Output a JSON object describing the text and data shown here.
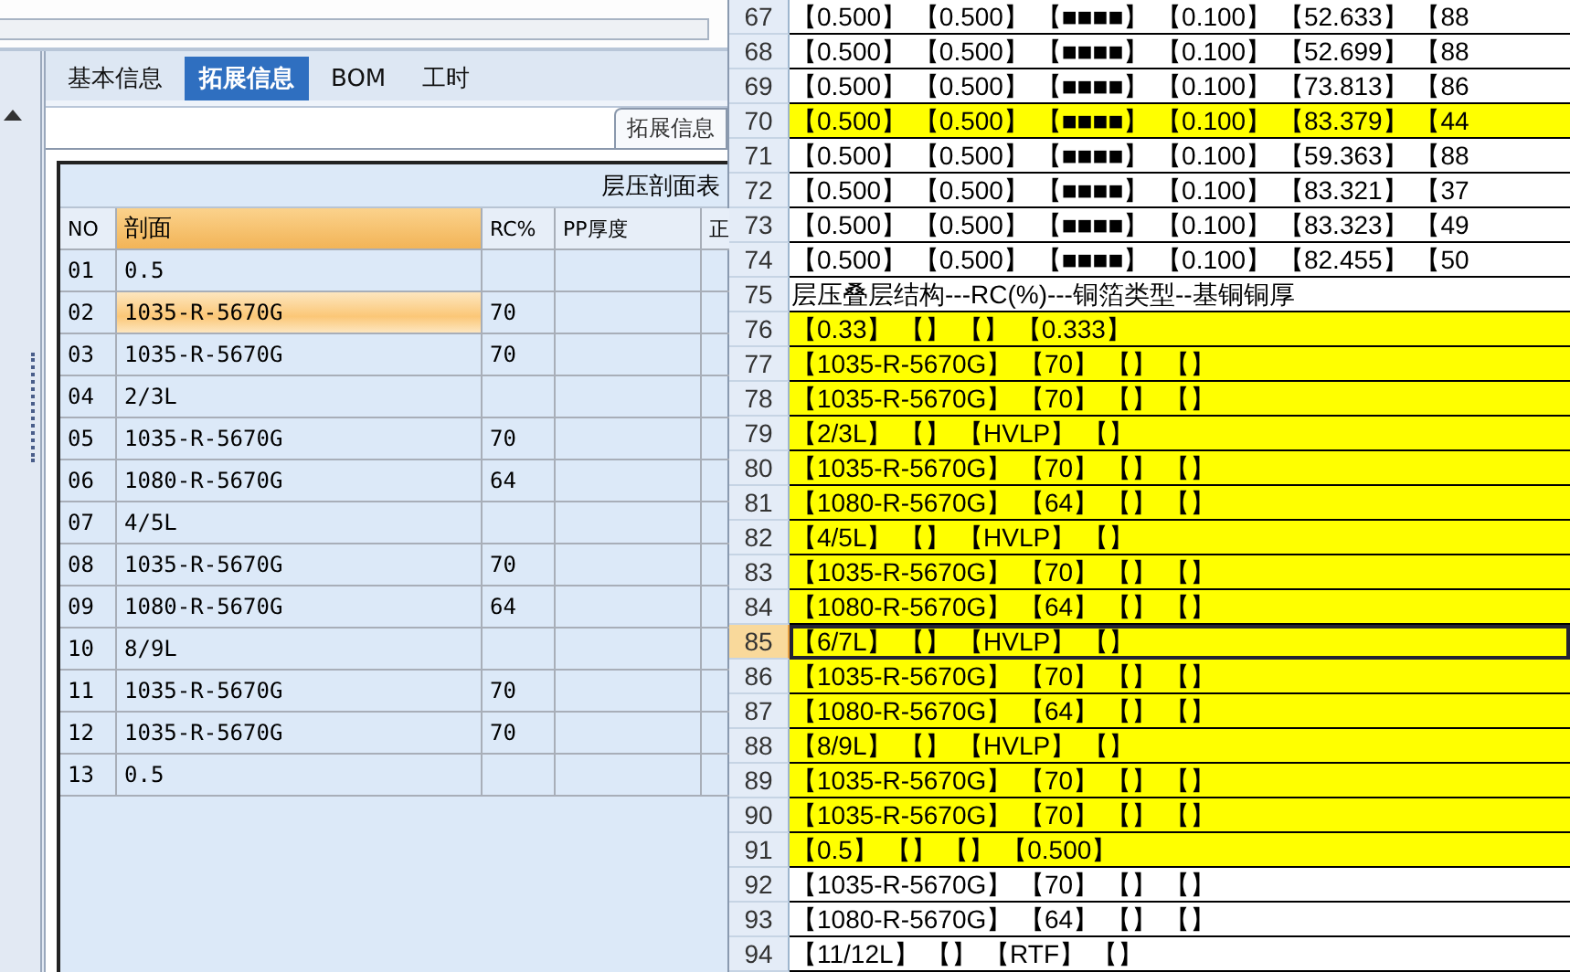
{
  "tabs": [
    {
      "label": "基本信息",
      "selected": false
    },
    {
      "label": "拓展信息",
      "selected": true
    },
    {
      "label": "BOM",
      "selected": false
    },
    {
      "label": "工时",
      "selected": false
    }
  ],
  "sub_tab": {
    "label": "拓展信息"
  },
  "grid": {
    "title": "层压剖面表",
    "columns": [
      {
        "label": "NO",
        "selected": false
      },
      {
        "label": "剖面",
        "selected": true
      },
      {
        "label": "RC%",
        "selected": false
      },
      {
        "label": "PP厚度",
        "selected": false
      },
      {
        "label": "正",
        "selected": false
      }
    ],
    "rows": [
      {
        "no": "01",
        "section": "0.5",
        "rc": "",
        "selected": false
      },
      {
        "no": "02",
        "section": "1035-R-5670G",
        "rc": "70",
        "selected": true
      },
      {
        "no": "03",
        "section": "1035-R-5670G",
        "rc": "70",
        "selected": false
      },
      {
        "no": "04",
        "section": "2/3L",
        "rc": "",
        "selected": false
      },
      {
        "no": "05",
        "section": "1035-R-5670G",
        "rc": "70",
        "selected": false
      },
      {
        "no": "06",
        "section": "1080-R-5670G",
        "rc": "64",
        "selected": false
      },
      {
        "no": "07",
        "section": "4/5L",
        "rc": "",
        "selected": false
      },
      {
        "no": "08",
        "section": "1035-R-5670G",
        "rc": "70",
        "selected": false
      },
      {
        "no": "09",
        "section": "1080-R-5670G",
        "rc": "64",
        "selected": false
      },
      {
        "no": "10",
        "section": "8/9L",
        "rc": "",
        "selected": false
      },
      {
        "no": "11",
        "section": "1035-R-5670G",
        "rc": "70",
        "selected": false
      },
      {
        "no": "12",
        "section": "1035-R-5670G",
        "rc": "70",
        "selected": false
      },
      {
        "no": "13",
        "section": "0.5",
        "rc": "",
        "selected": false
      }
    ]
  },
  "sheet": {
    "rows": [
      {
        "number": "67",
        "text": "【0.500】 【0.500】 【■■■■】 【0.100】 【52.633】 【88",
        "highlighted": false,
        "selected": false
      },
      {
        "number": "68",
        "text": "【0.500】 【0.500】 【■■■■】 【0.100】 【52.699】 【88",
        "highlighted": false,
        "selected": false
      },
      {
        "number": "69",
        "text": "【0.500】 【0.500】 【■■■■】 【0.100】 【73.813】 【86",
        "highlighted": false,
        "selected": false
      },
      {
        "number": "70",
        "text": "【0.500】 【0.500】 【■■■■】 【0.100】 【83.379】 【44",
        "highlighted": true,
        "selected": false
      },
      {
        "number": "71",
        "text": "【0.500】 【0.500】 【■■■■】 【0.100】 【59.363】 【88",
        "highlighted": false,
        "selected": false
      },
      {
        "number": "72",
        "text": "【0.500】 【0.500】 【■■■■】 【0.100】 【83.321】 【37",
        "highlighted": false,
        "selected": false
      },
      {
        "number": "73",
        "text": "【0.500】 【0.500】 【■■■■】 【0.100】 【83.323】 【49",
        "highlighted": false,
        "selected": false
      },
      {
        "number": "74",
        "text": "【0.500】 【0.500】 【■■■■】 【0.100】 【82.455】 【50",
        "highlighted": false,
        "selected": false
      },
      {
        "number": "75",
        "text": "层压叠层结构---RC(%)---铜箔类型--基铜铜厚",
        "highlighted": false,
        "selected": false
      },
      {
        "number": "76",
        "text": "【0.33】 【】 【】 【0.333】",
        "highlighted": true,
        "selected": false
      },
      {
        "number": "77",
        "text": "【1035-R-5670G】 【70】 【】 【】",
        "highlighted": true,
        "selected": false
      },
      {
        "number": "78",
        "text": "【1035-R-5670G】 【70】 【】 【】",
        "highlighted": true,
        "selected": false
      },
      {
        "number": "79",
        "text": "【2/3L】 【】 【HVLP】 【】",
        "highlighted": true,
        "selected": false
      },
      {
        "number": "80",
        "text": "【1035-R-5670G】 【70】 【】 【】",
        "highlighted": true,
        "selected": false
      },
      {
        "number": "81",
        "text": "【1080-R-5670G】 【64】 【】 【】",
        "highlighted": true,
        "selected": false
      },
      {
        "number": "82",
        "text": "【4/5L】 【】 【HVLP】 【】",
        "highlighted": true,
        "selected": false
      },
      {
        "number": "83",
        "text": "【1035-R-5670G】 【70】 【】 【】",
        "highlighted": true,
        "selected": false
      },
      {
        "number": "84",
        "text": "【1080-R-5670G】 【64】 【】 【】",
        "highlighted": true,
        "selected": false
      },
      {
        "number": "85",
        "text": "【6/7L】 【】 【HVLP】 【】",
        "highlighted": true,
        "selected": true
      },
      {
        "number": "86",
        "text": "【1035-R-5670G】 【70】 【】 【】",
        "highlighted": true,
        "selected": false
      },
      {
        "number": "87",
        "text": "【1080-R-5670G】 【64】 【】 【】",
        "highlighted": true,
        "selected": false
      },
      {
        "number": "88",
        "text": "【8/9L】 【】 【HVLP】 【】",
        "highlighted": true,
        "selected": false
      },
      {
        "number": "89",
        "text": "【1035-R-5670G】 【70】 【】 【】",
        "highlighted": true,
        "selected": false
      },
      {
        "number": "90",
        "text": "【1035-R-5670G】 【70】 【】 【】",
        "highlighted": true,
        "selected": false
      },
      {
        "number": "91",
        "text": "【0.5】 【】 【】 【0.500】",
        "highlighted": true,
        "selected": false
      },
      {
        "number": "92",
        "text": "【1035-R-5670G】 【70】 【】 【】",
        "highlighted": false,
        "selected": false
      },
      {
        "number": "93",
        "text": "【1080-R-5670G】 【64】 【】 【】",
        "highlighted": false,
        "selected": false
      },
      {
        "number": "94",
        "text": "【11/12L】 【】 【RTF】 【】",
        "highlighted": false,
        "selected": false
      }
    ]
  }
}
